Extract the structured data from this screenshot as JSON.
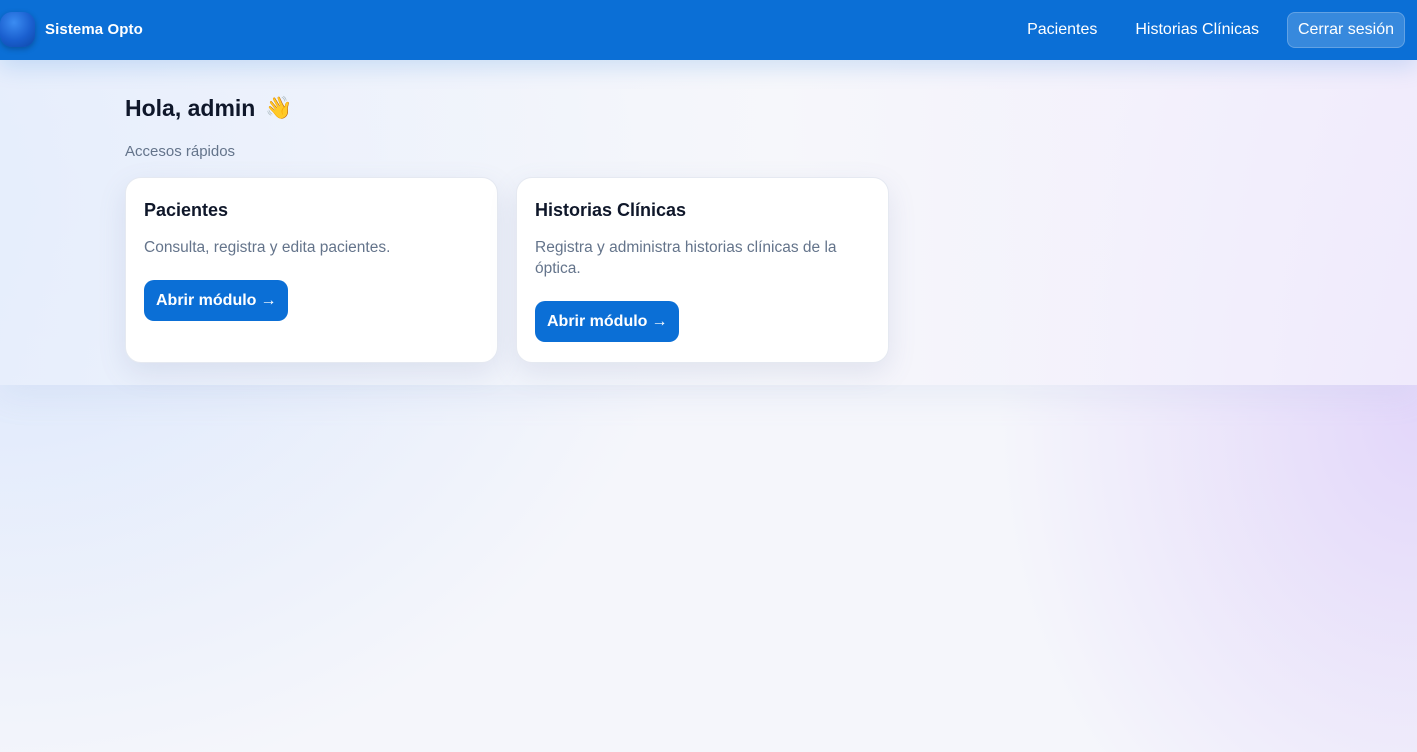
{
  "header": {
    "brand_name": "Sistema Opto",
    "brand_logo_icon": "app-logo-icon",
    "nav": [
      {
        "label": "Pacientes"
      },
      {
        "label": "Historias Clínicas"
      }
    ],
    "logout_label": "Cerrar sesión",
    "color": "#0b6fd6"
  },
  "main": {
    "greeting": "Hola, admin",
    "greeting_icon": "👋",
    "section_label": "Accesos rápidos",
    "cards": [
      {
        "title": "Pacientes",
        "description": "Consulta, registra y edita pacientes.",
        "button_label": "Abrir módulo",
        "button_arrow": "→"
      },
      {
        "title": "Historias Clínicas",
        "description": "Registra y administra historias clínicas de la óptica.",
        "button_label": "Abrir módulo",
        "button_arrow": "→"
      }
    ]
  }
}
